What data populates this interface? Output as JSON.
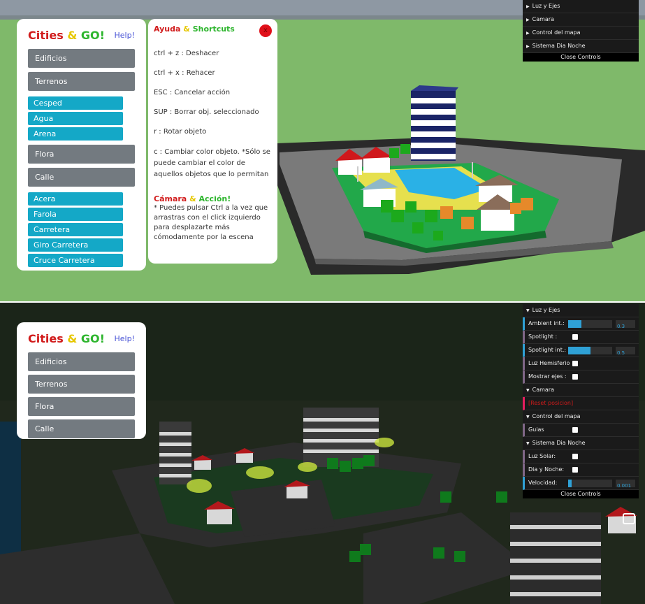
{
  "menu": {
    "brand": {
      "word1": "Cities",
      "amp": "&",
      "word2": "GO!"
    },
    "help_link": "Help!",
    "buttons": [
      "Edificios",
      "Terrenos"
    ],
    "terrain_options": [
      "Cesped",
      "Agua",
      "Arena"
    ],
    "more_buttons": [
      "Flora",
      "Calle"
    ],
    "street_options": [
      "Acera",
      "Farola",
      "Carretera",
      "Giro Carretera",
      "Cruce Carretera"
    ]
  },
  "help_panel": {
    "title_part1": "Ayuda",
    "title_amp": "&",
    "title_part2": "Shortcuts",
    "close_glyph": "x",
    "shortcuts": [
      "ctrl + z : Deshacer",
      "ctrl + x : Rehacer",
      "ESC : Cancelar acción",
      "SUP : Borrar obj. seleccionado",
      "r : Rotar objeto",
      "c : Cambiar color objeto. *Sólo se puede cambiar el color de aquellos objetos que lo permitan"
    ],
    "camera_title_part1": "Cámara",
    "camera_title_amp": "&",
    "camera_title_part2": "Acción!",
    "camera_text": "* Puedes pulsar Ctrl a la vez que arrastras con el click izquierdo para desplazarte más cómodamente por la escena"
  },
  "gui_collapsed": {
    "folders": [
      "Luz y Ejes",
      "Camara",
      "Control del mapa",
      "Sistema Dia Noche"
    ],
    "close_label": "Close Controls"
  },
  "gui_expanded": {
    "luz_title": "Luz y Ejes",
    "ambient_label": "Ambient int.:",
    "ambient_value": "0.3",
    "ambient_fraction": 0.3,
    "spotlight_label": "Spotlight :",
    "spot_int_label": "Spotlight int.:",
    "spot_int_value": "0.5",
    "spot_int_fraction": 0.5,
    "hemi_label": "Luz Hemisferio :",
    "axes_label": "Mostrar ejes :",
    "camera_title": "Camara",
    "reset_label": "[Reset posicion]",
    "map_title": "Control del mapa",
    "guides_label": "Guias",
    "daynight_title": "Sistema Dia Noche",
    "solar_label": "Luz Solar:",
    "day_night_label": "Dia y Noche:",
    "speed_label": "Velocidad:",
    "speed_value": "0.001",
    "speed_fraction": 0.08,
    "close_label": "Close Controls"
  },
  "colors": {
    "accent_blue": "#2fa1d6",
    "brand_red": "#d11b1b",
    "brand_yellow": "#e6c700",
    "brand_green": "#2db52d",
    "submenu_cyan": "#14a8c7",
    "button_grey": "#737a80"
  }
}
